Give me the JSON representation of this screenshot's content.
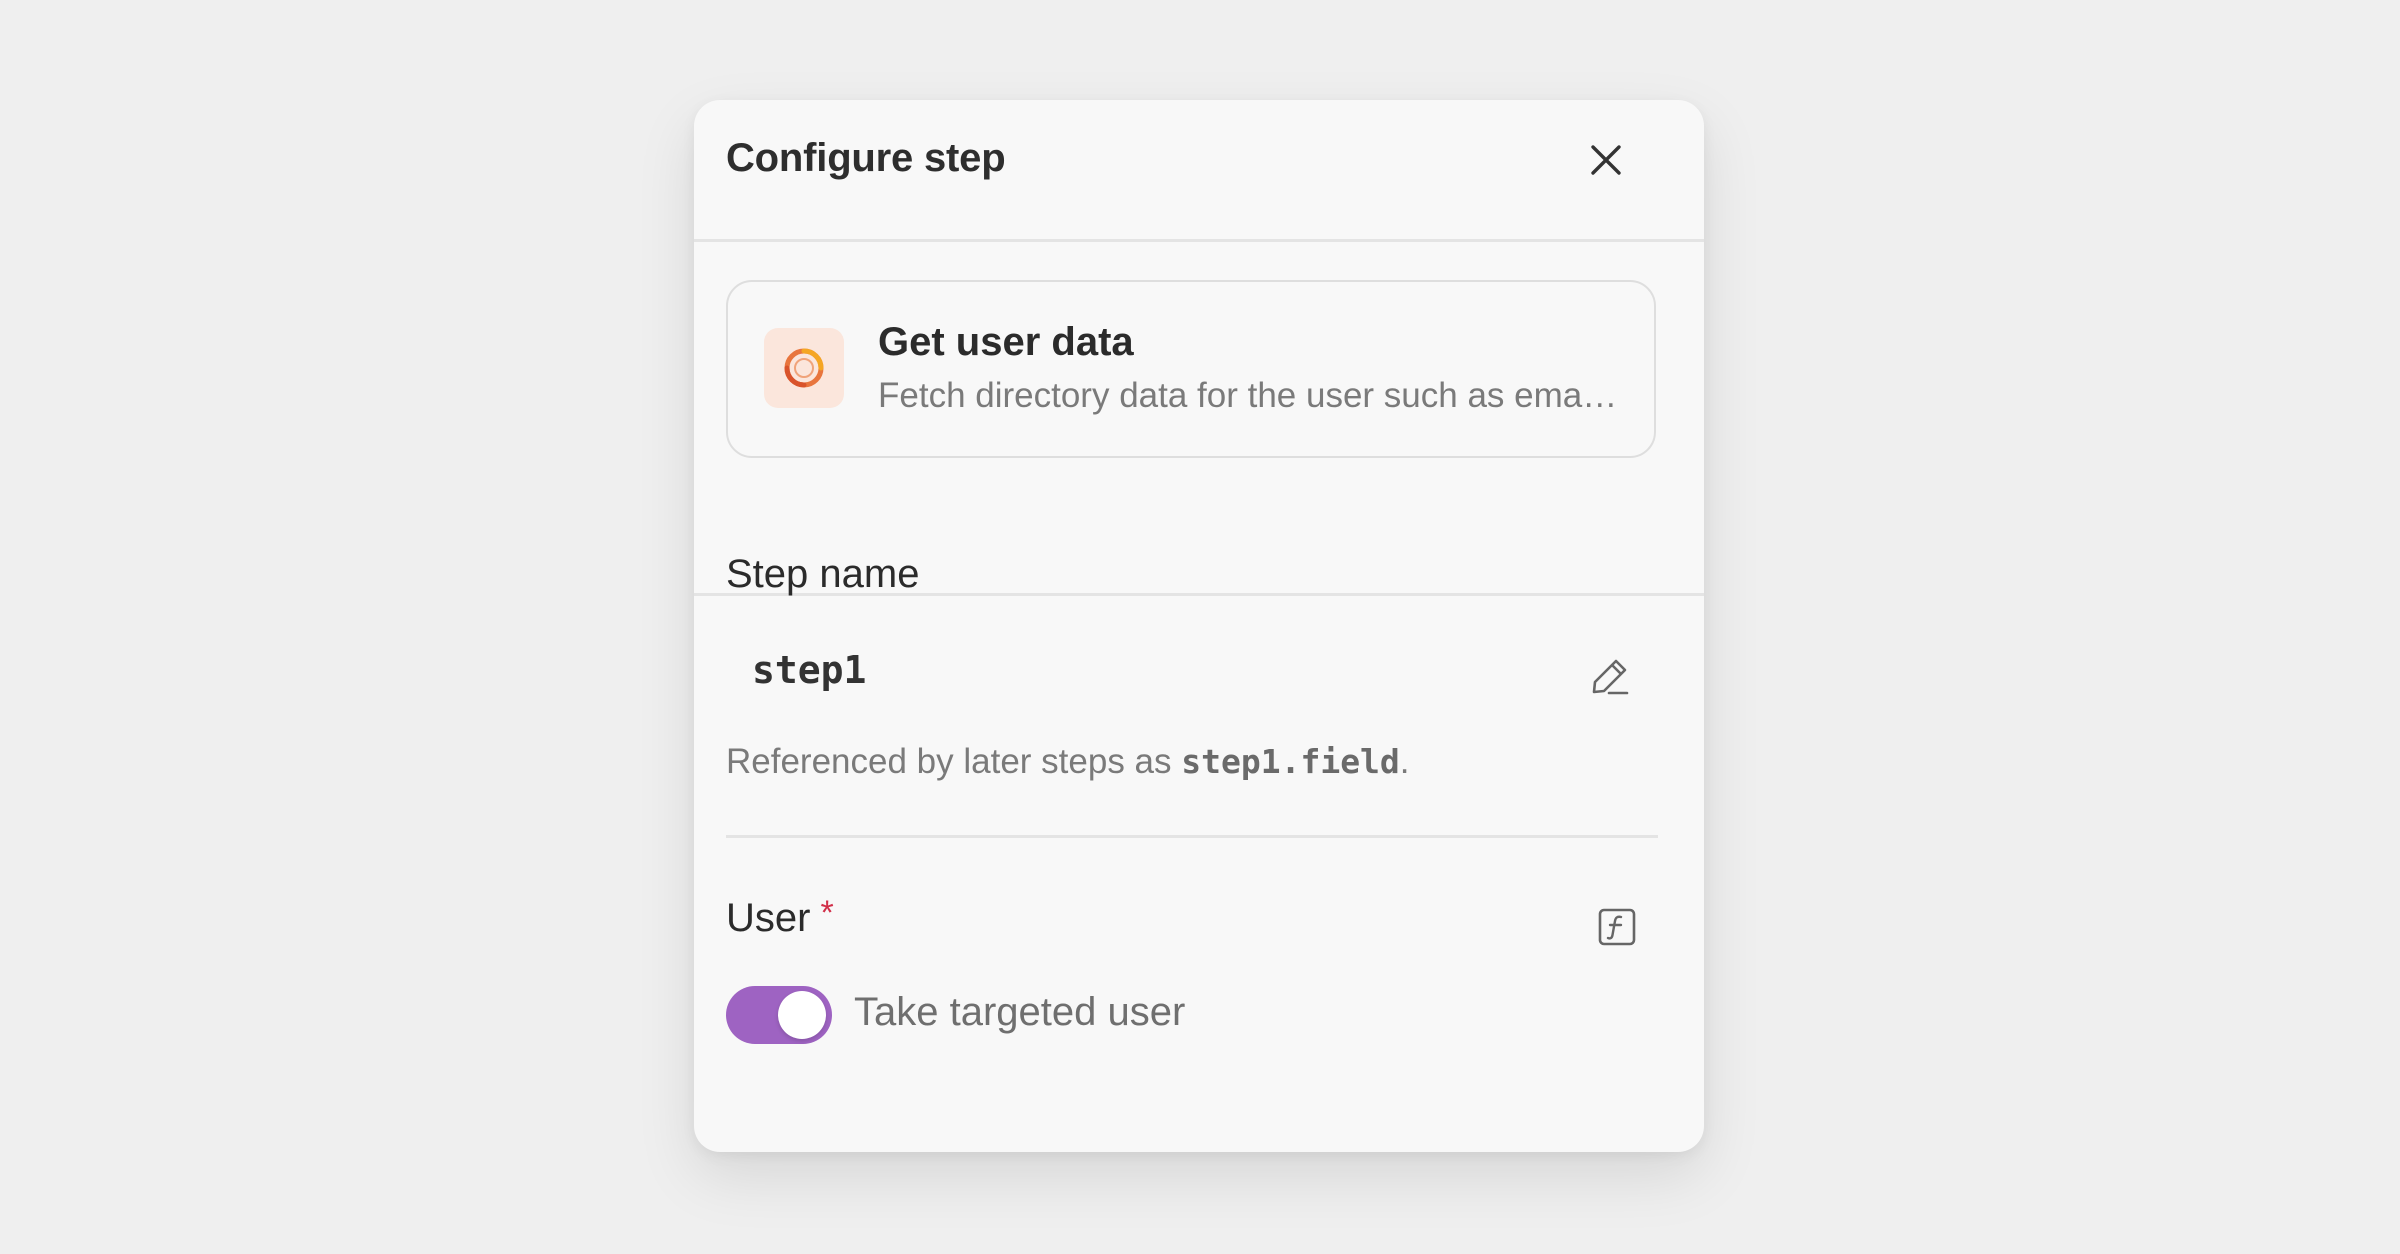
{
  "panel": {
    "title": "Configure step"
  },
  "action": {
    "title": "Get user data",
    "description": "Fetch directory data for the user such as email, manager, department and title",
    "icon": "orange-ring-icon",
    "accent_color": "#e8753d"
  },
  "step_name": {
    "label": "Step name",
    "value": "step1",
    "helper_prefix": "Referenced by later steps as ",
    "helper_code": "step1.field",
    "helper_suffix": "."
  },
  "user": {
    "label": "User",
    "required_marker": "*",
    "toggle_on": true,
    "toggle_label": "Take targeted user",
    "toggle_color": "#9e63c2"
  },
  "icons": {
    "close": "close-icon",
    "edit": "pencil-icon",
    "function": "function-icon"
  }
}
